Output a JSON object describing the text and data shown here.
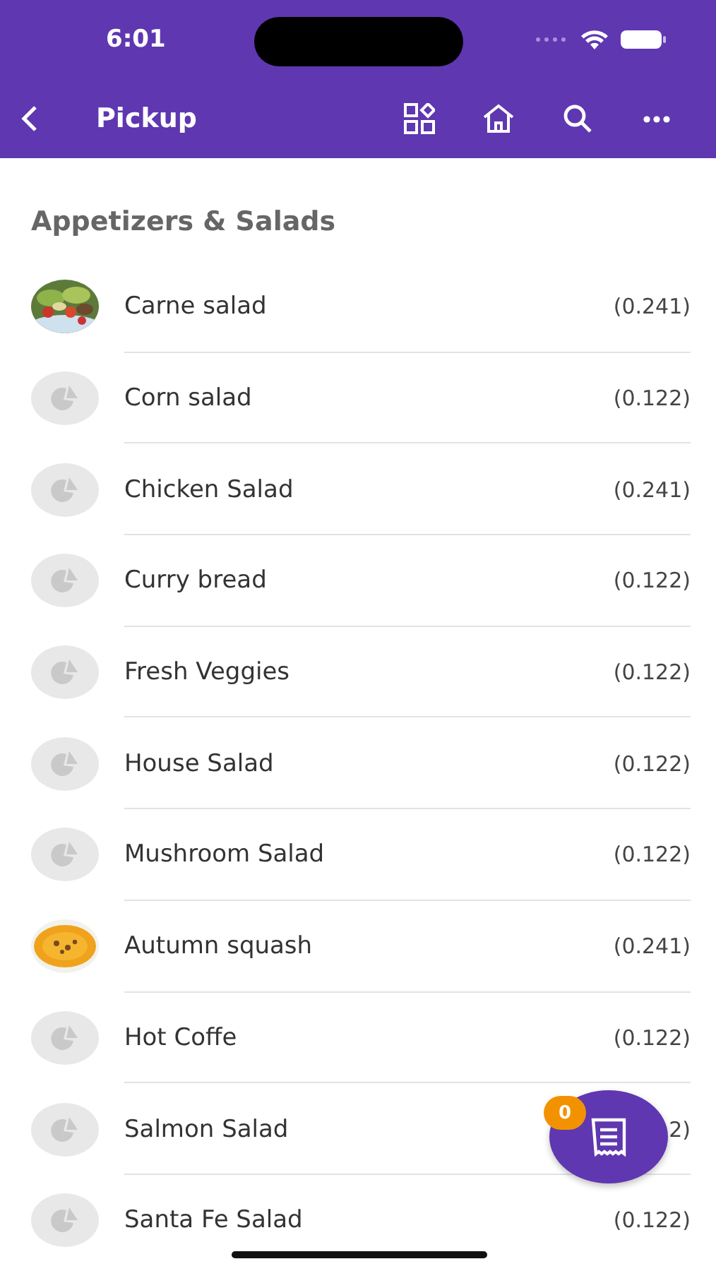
{
  "status_bar": {
    "time": "6:01"
  },
  "nav": {
    "title": "Pickup"
  },
  "section": {
    "title": "Appetizers & Salads"
  },
  "items": [
    {
      "name": "Carne salad",
      "price": "(0.241)"
    },
    {
      "kind": "placeholder",
      "name": "Corn salad",
      "price": "(0.122)"
    },
    {
      "kind": "placeholder",
      "name": "Chicken Salad",
      "price": "(0.241)"
    },
    {
      "kind": "placeholder",
      "name": "Curry bread",
      "price": "(0.122)"
    },
    {
      "kind": "placeholder",
      "name": "Fresh Veggies",
      "price": "(0.122)"
    },
    {
      "kind": "placeholder",
      "name": "House Salad",
      "price": "(0.122)"
    },
    {
      "kind": "placeholder",
      "name": "Mushroom Salad",
      "price": "(0.122)"
    },
    {
      "kind": "soup",
      "name": "Autumn squash",
      "price": "(0.241)"
    },
    {
      "kind": "placeholder",
      "name": "Hot Coffe",
      "price": "(0.122)"
    },
    {
      "kind": "placeholder",
      "name": "Salmon Salad",
      "price": "2)"
    },
    {
      "kind": "placeholder",
      "name": "Santa Fe Salad",
      "price": "(0.122)"
    }
  ],
  "cart": {
    "count": "0"
  }
}
